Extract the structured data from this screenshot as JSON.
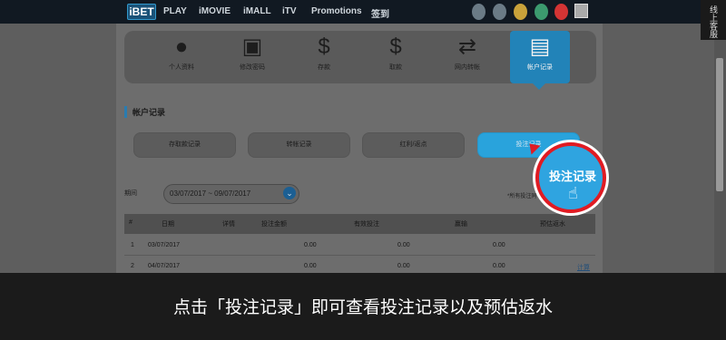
{
  "nav": {
    "logo": "iBET",
    "items": [
      "PLAY",
      "iMOVIE",
      "iMALL",
      "iTV",
      "Promotions",
      "签到"
    ],
    "side_tab": "线上客服"
  },
  "account_menu": {
    "items": [
      {
        "label": "个人资料",
        "icon": "user-icon"
      },
      {
        "label": "修改密码",
        "icon": "lock-icon"
      },
      {
        "label": "存款",
        "icon": "deposit-icon"
      },
      {
        "label": "取款",
        "icon": "withdraw-icon"
      },
      {
        "label": "网内转帐",
        "icon": "transfer-icon"
      },
      {
        "label": "帐户记录",
        "icon": "records-icon"
      }
    ],
    "active": "帐户记录"
  },
  "section": {
    "title": "帐户记录"
  },
  "sub_tabs": [
    "存取款记录",
    "转帐记录",
    "红利/返点",
    "投注记录"
  ],
  "filter": {
    "period_label": "期间",
    "date_range": "03/07/2017 ~ 09/07/2017",
    "note": "*所有投注同"
  },
  "table": {
    "headers": [
      "#",
      "日期",
      "详情",
      "投注金额",
      "有效投注",
      "赢输",
      "预估返水"
    ],
    "rows": [
      {
        "no": "1",
        "date": "03/07/2017",
        "bet": "0.00",
        "valid": "0.00",
        "winloss": "0.00",
        "rebate": ""
      },
      {
        "no": "2",
        "date": "04/07/2017",
        "bet": "0.00",
        "valid": "0.00",
        "winloss": "0.00",
        "rebate": "计算"
      }
    ]
  },
  "callout": {
    "text": "投注记录"
  },
  "caption": "点击「投注记录」即可查看投注记录以及预估返水",
  "colors": {
    "accent": "#2283b8",
    "callout_ring": "#e01b23"
  }
}
